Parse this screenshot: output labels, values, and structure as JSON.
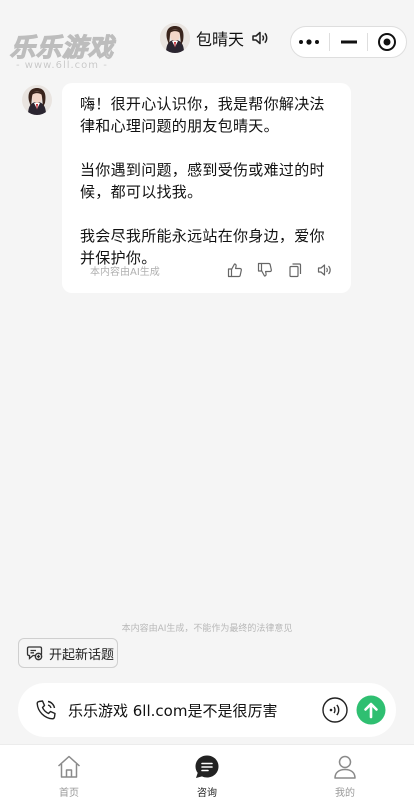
{
  "watermark": {
    "title": "乐乐游戏",
    "url": "- www.6ll.com -"
  },
  "header": {
    "title": "包晴天"
  },
  "message": {
    "paragraphs": [
      "嗨！很开心认识你，我是帮你解决法律和心理问题的朋友包晴天。",
      "当你遇到问题，感到受伤或难过的时候，都可以找我。",
      "我会尽我所能永远站在你身边，爱你并保护你。"
    ],
    "ai_note": "本内容由AI生成"
  },
  "disclaimer": "本内容由AI生成，不能作为最终的法律意见",
  "new_topic_label": "开起新话题",
  "input": {
    "value": "乐乐游戏 6ll.com是不是很厉害"
  },
  "tabs": [
    {
      "label": "首页",
      "icon": "home-icon"
    },
    {
      "label": "咨询",
      "icon": "chat-icon"
    },
    {
      "label": "我的",
      "icon": "user-icon"
    }
  ],
  "colors": {
    "accent": "#2fbf71",
    "background": "#f5f5f5"
  }
}
